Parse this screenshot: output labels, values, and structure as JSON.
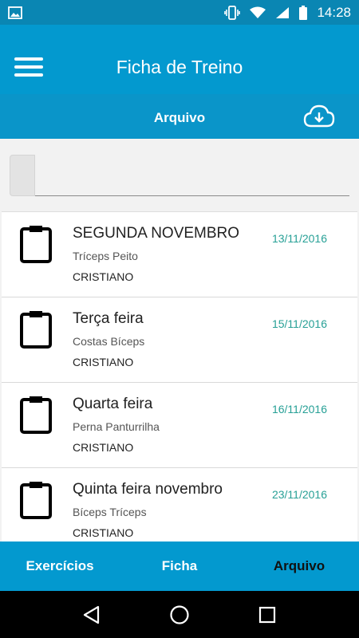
{
  "status_bar": {
    "time": "14:28",
    "icons": [
      "image-icon",
      "vibrate-icon",
      "wifi-icon",
      "signal-icon",
      "battery-icon"
    ]
  },
  "app_bar": {
    "title": "Ficha de Treino",
    "menu_icon": "hamburger-menu-icon"
  },
  "sub_bar": {
    "label": "Arquivo",
    "cloud_icon": "cloud-download-icon"
  },
  "search": {
    "value": "",
    "placeholder": ""
  },
  "workouts": [
    {
      "name": "SEGUNDA NOVEMBRO",
      "muscles": "Tríceps Peito",
      "owner": "CRISTIANO",
      "date": "13/11/2016"
    },
    {
      "name": "Terça feira",
      "muscles": "Costas Bíceps",
      "owner": "CRISTIANO",
      "date": "15/11/2016"
    },
    {
      "name": "Quarta feira",
      "muscles": "Perna Panturrilha",
      "owner": "CRISTIANO",
      "date": "16/11/2016"
    },
    {
      "name": "Quinta feira novembro",
      "muscles": "Bíceps Tríceps",
      "owner": "CRISTIANO",
      "date": "23/11/2016"
    }
  ],
  "bottom_nav": {
    "tabs": [
      {
        "label": "Exercícios",
        "active": false
      },
      {
        "label": "Ficha",
        "active": false
      },
      {
        "label": "Arquivo",
        "active": true
      }
    ]
  },
  "system_nav": {
    "icons": [
      "back-icon",
      "home-icon",
      "recents-icon"
    ]
  },
  "colors": {
    "primary": "#0399cf",
    "status_bar": "#0a86b3",
    "date_text": "#27a096"
  }
}
